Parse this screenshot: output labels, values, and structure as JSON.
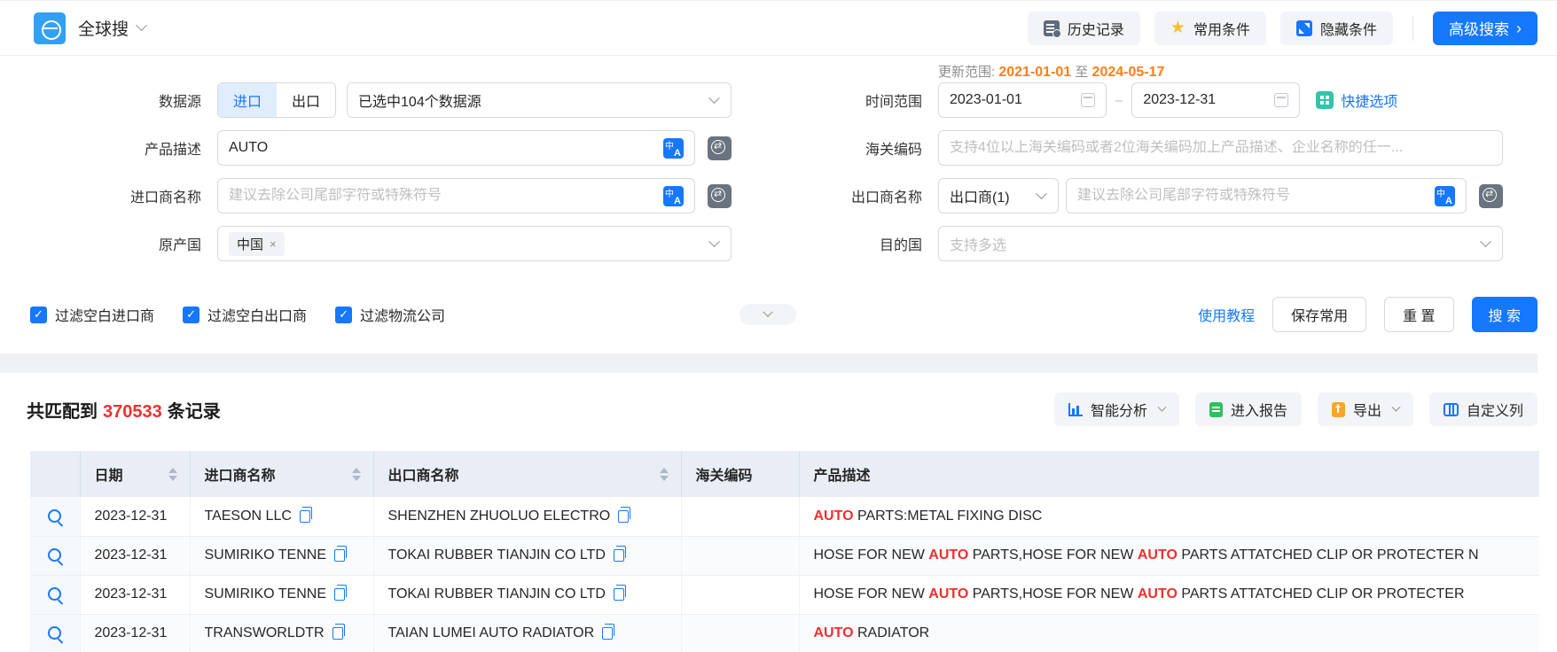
{
  "header": {
    "app_title": "全球搜",
    "history_label": "历史记录",
    "favorites_label": "常用条件",
    "hide_conditions_label": "隐藏条件",
    "advanced_search_label": "高级搜索",
    "advanced_search_arrow": "›"
  },
  "form": {
    "update_range": {
      "label": "更新范围:",
      "start": "2021-01-01",
      "to": "至",
      "end": "2024-05-17"
    },
    "data_source": {
      "label": "数据源",
      "import": "进口",
      "export": "出口",
      "selected": "已选中104个数据源"
    },
    "time_range": {
      "label": "时间范围",
      "start": "2023-01-01",
      "end": "2023-12-31",
      "dash": "–",
      "quick_label": "快捷选项"
    },
    "product_desc": {
      "label": "产品描述",
      "value": "AUTO"
    },
    "hs_code": {
      "label": "海关编码",
      "placeholder": "支持4位以上海关编码或者2位海关编码加上产品描述、企业名称的任一..."
    },
    "importer": {
      "label": "进口商名称",
      "placeholder": "建议去除公司尾部字符或特殊符号"
    },
    "exporter": {
      "label": "出口商名称",
      "type_selected": "出口商(1)",
      "placeholder": "建议去除公司尾部字符或特殊符号"
    },
    "origin_country": {
      "label": "原产国",
      "tag": "中国",
      "tag_close": "×"
    },
    "dest_country": {
      "label": "目的国",
      "placeholder": "支持多选"
    },
    "filters": [
      "过滤空白进口商",
      "过滤空白出口商",
      "过滤物流公司"
    ],
    "tutorial_link": "使用教程",
    "save_button": "保存常用",
    "reset_button": "重 置",
    "search_button": "搜 索"
  },
  "results": {
    "count_prefix": "共匹配到",
    "count": "370533",
    "count_suffix": "条记录",
    "toolbar": {
      "analysis": "智能分析",
      "report": "进入报告",
      "export": "导出",
      "custom_columns": "自定义列"
    },
    "table": {
      "headers": [
        {
          "label": ""
        },
        {
          "label": "日期"
        },
        {
          "label": "进口商名称"
        },
        {
          "label": "出口商名称"
        },
        {
          "label": "海关编码"
        },
        {
          "label": "产品描述"
        }
      ],
      "rows": [
        {
          "date": "2023-12-31",
          "importer": "TAESON LLC",
          "exporter": "SHENZHEN ZHUOLUO ELECTRO",
          "hs_code": "",
          "desc": [
            {
              "text": "AUTO",
              "hl": true
            },
            {
              "text": " PARTS:METAL FIXING DISC",
              "hl": false
            }
          ]
        },
        {
          "date": "2023-12-31",
          "importer": "SUMIRIKO TENNE",
          "exporter": "TOKAI RUBBER TIANJIN CO LTD",
          "hs_code": "",
          "desc": [
            {
              "text": "HOSE FOR NEW ",
              "hl": false
            },
            {
              "text": "AUTO",
              "hl": true
            },
            {
              "text": " PARTS,HOSE FOR NEW ",
              "hl": false
            },
            {
              "text": "AUTO",
              "hl": true
            },
            {
              "text": " PARTS ATTATCHED CLIP OR PROTECTER N",
              "hl": false
            }
          ]
        },
        {
          "date": "2023-12-31",
          "importer": "SUMIRIKO TENNE",
          "exporter": "TOKAI RUBBER TIANJIN CO LTD",
          "hs_code": "",
          "desc": [
            {
              "text": "HOSE FOR NEW ",
              "hl": false
            },
            {
              "text": "AUTO",
              "hl": true
            },
            {
              "text": " PARTS,HOSE FOR NEW ",
              "hl": false
            },
            {
              "text": "AUTO",
              "hl": true
            },
            {
              "text": " PARTS ATTATCHED CLIP OR PROTECTER",
              "hl": false
            }
          ]
        },
        {
          "date": "2023-12-31",
          "importer": "TRANSWORLDTR",
          "exporter": "TAIAN LUMEI AUTO RADIATOR",
          "hs_code": "",
          "desc": [
            {
              "text": "AUTO",
              "hl": true
            },
            {
              "text": " RADIATOR",
              "hl": false
            }
          ]
        }
      ]
    },
    "colors": {
      "accent": "#1677ff",
      "highlight_red": "#f22e2e",
      "range_orange": "#ff7d1a"
    }
  }
}
